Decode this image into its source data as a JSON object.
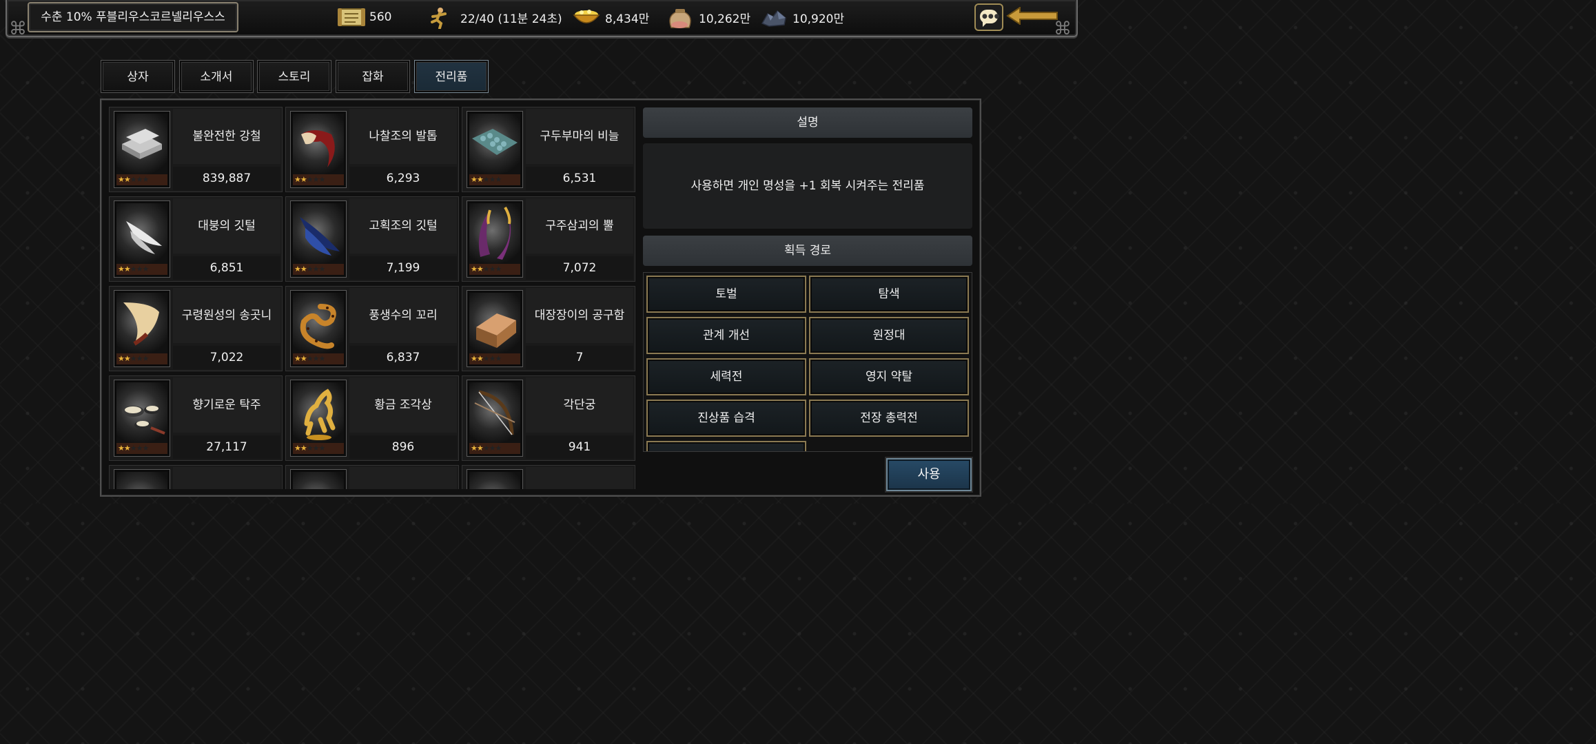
{
  "header": {
    "status_text": "수춘 10% 푸블리우스코르넬리우스스",
    "resources": [
      {
        "icon": "scroll-icon",
        "value": "560"
      },
      {
        "icon": "running-soldier-icon",
        "value": "22/40 (11분 24초)"
      },
      {
        "icon": "gold-basket-icon",
        "value": "8,434만"
      },
      {
        "icon": "food-sack-icon",
        "value": "10,262만"
      },
      {
        "icon": "iron-ore-icon",
        "value": "10,920만"
      }
    ],
    "chat_icon": "chat-bubble-icon",
    "back_icon": "back-arrow-icon"
  },
  "tabs": [
    {
      "label": "상자",
      "active": false
    },
    {
      "label": "소개서",
      "active": false
    },
    {
      "label": "스토리",
      "active": false
    },
    {
      "label": "잡화",
      "active": false
    },
    {
      "label": "전리품",
      "active": true
    }
  ],
  "items": [
    {
      "name": "불완전한 강철",
      "count": "839,887",
      "stars": 2,
      "icon": "steel-ingot-icon"
    },
    {
      "name": "나찰조의 발톱",
      "count": "6,293",
      "stars": 2,
      "icon": "claw-icon"
    },
    {
      "name": "구두부마의 비늘",
      "count": "6,531",
      "stars": 2,
      "icon": "scale-icon"
    },
    {
      "name": "대붕의 깃털",
      "count": "6,851",
      "stars": 2,
      "icon": "white-feather-icon"
    },
    {
      "name": "고획조의 깃털",
      "count": "7,199",
      "stars": 2,
      "icon": "blue-feather-icon"
    },
    {
      "name": "구주삼괴의 뿔",
      "count": "7,072",
      "stars": 2,
      "icon": "horn-icon"
    },
    {
      "name": "구령원성의 송곳니",
      "count": "7,022",
      "stars": 2,
      "icon": "fang-icon"
    },
    {
      "name": "풍생수의 꼬리",
      "count": "6,837",
      "stars": 2,
      "icon": "leopard-tail-icon"
    },
    {
      "name": "대장장이의 공구함",
      "count": "7",
      "stars": 2,
      "icon": "toolbox-icon"
    },
    {
      "name": "향기로운 탁주",
      "count": "27,117",
      "stars": 2,
      "icon": "rice-wine-icon"
    },
    {
      "name": "황금 조각상",
      "count": "896",
      "stars": 2,
      "icon": "golden-horse-statue-icon"
    },
    {
      "name": "각단궁",
      "count": "941",
      "stars": 2,
      "icon": "bow-icon"
    }
  ],
  "detail": {
    "description_header": "설명",
    "description_text": "사용하면 개인 명성을 +1 회복 시켜주는 전리품",
    "source_header": "획득 경로",
    "sources": [
      "토벌",
      "탐색",
      "관계 개선",
      "원정대",
      "세력전",
      "영지 약탈",
      "진상품 습격",
      "전장 총력전"
    ],
    "use_label": "사용"
  }
}
